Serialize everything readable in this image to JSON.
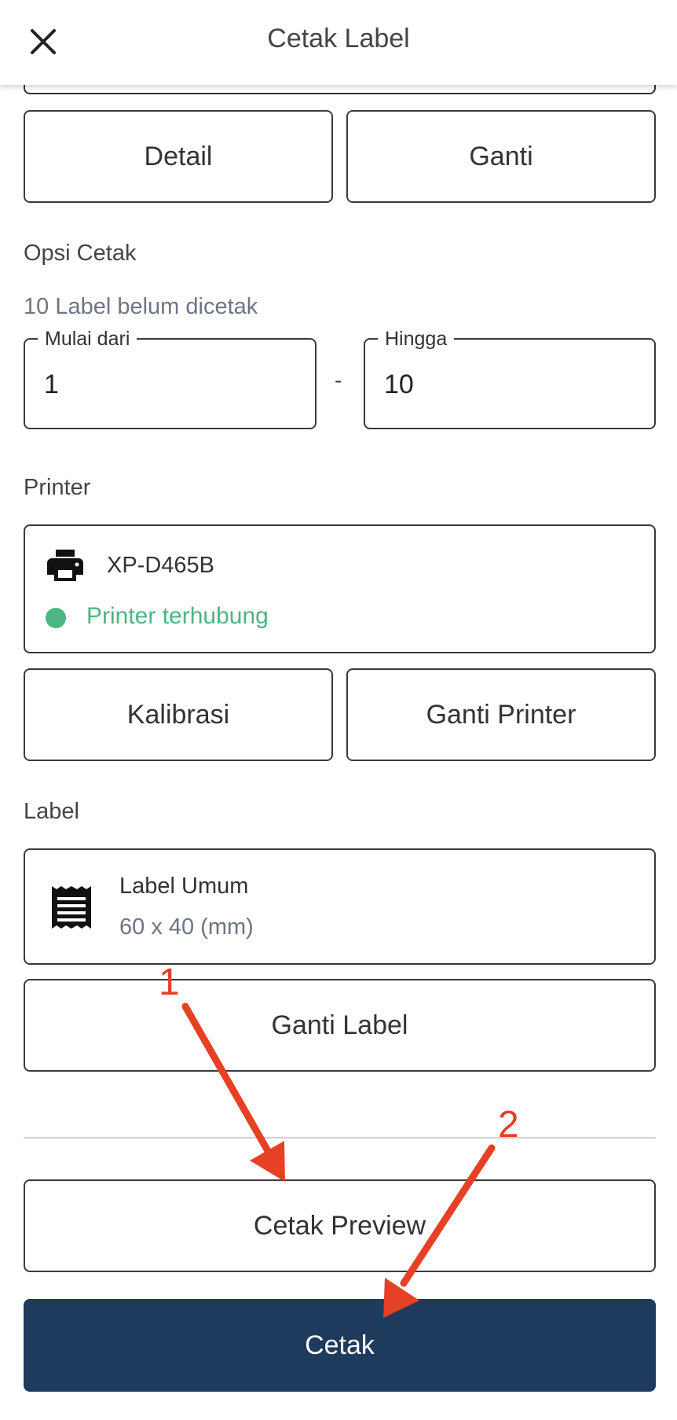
{
  "appbar": {
    "title": "Cetak Label",
    "close_icon": "close-icon"
  },
  "top_actions": {
    "detail_label": "Detail",
    "ganti_label": "Ganti"
  },
  "print_options": {
    "section_title": "Opsi Cetak",
    "unprinted_info": "10 Label belum dicetak",
    "start": {
      "label": "Mulai dari",
      "value": "1"
    },
    "separator": "-",
    "end": {
      "label": "Hingga",
      "value": "10"
    }
  },
  "printer": {
    "section_title": "Printer",
    "icon": "printer-icon",
    "name": "XP-D465B",
    "status": "Printer terhubung",
    "status_color": "#4cb581",
    "calibrate_label": "Kalibrasi",
    "change_printer_label": "Ganti Printer"
  },
  "label": {
    "section_title": "Label",
    "icon": "receipt-icon",
    "name": "Label Umum",
    "size": "60 x 40 (mm)",
    "change_label": "Ganti Label"
  },
  "footer": {
    "preview_label": "Cetak Preview",
    "print_label": "Cetak",
    "primary_color": "#1e3a5c"
  },
  "annotations": {
    "first": "1",
    "second": "2",
    "arrow_color": "#e64027"
  }
}
